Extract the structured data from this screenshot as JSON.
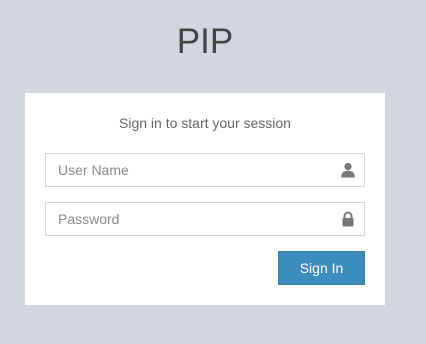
{
  "app": {
    "logo_text": "PIP"
  },
  "login": {
    "message": "Sign in to start your session",
    "username": {
      "placeholder": "User Name",
      "value": "",
      "icon": "user-icon"
    },
    "password": {
      "placeholder": "Password",
      "value": "",
      "icon": "lock-icon"
    },
    "submit_label": "Sign In"
  },
  "colors": {
    "page_background": "#d2d6de",
    "box_background": "#ffffff",
    "button": "#3c8dbc",
    "icon": "#777777"
  }
}
